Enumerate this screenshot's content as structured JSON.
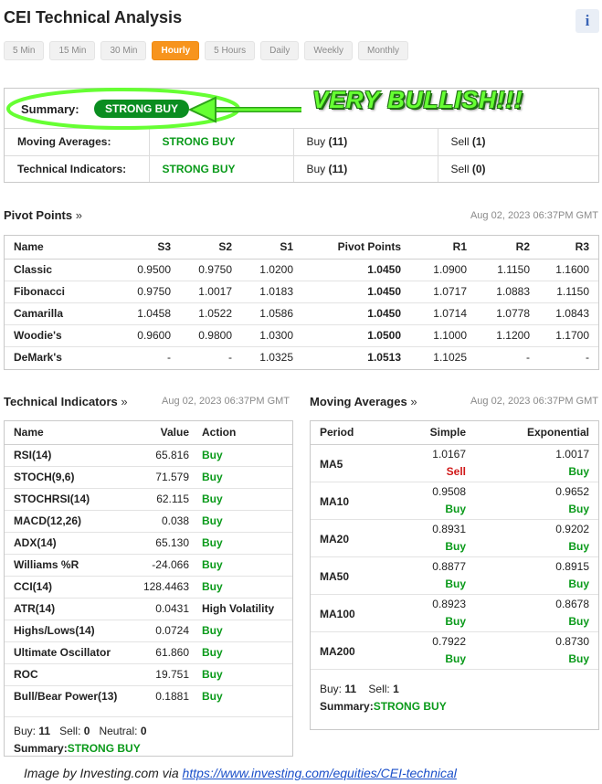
{
  "header": {
    "title": "CEI Technical Analysis",
    "info_icon": "info-icon"
  },
  "tabs": [
    {
      "label": "5 Min",
      "active": false
    },
    {
      "label": "15 Min",
      "active": false
    },
    {
      "label": "30 Min",
      "active": false
    },
    {
      "label": "Hourly",
      "active": true
    },
    {
      "label": "5 Hours",
      "active": false
    },
    {
      "label": "Daily",
      "active": false
    },
    {
      "label": "Weekly",
      "active": false
    },
    {
      "label": "Monthly",
      "active": false
    }
  ],
  "summary": {
    "label": "Summary:",
    "value": "STRONG BUY",
    "annotation": "VERY BULLISH!!!",
    "rows": [
      {
        "name": "Moving Averages:",
        "signal": "STRONG BUY",
        "buy_label": "Buy",
        "buy_count": "(11)",
        "sell_label": "Sell",
        "sell_count": "(1)"
      },
      {
        "name": "Technical Indicators:",
        "signal": "STRONG BUY",
        "buy_label": "Buy",
        "buy_count": "(11)",
        "sell_label": "Sell",
        "sell_count": "(0)"
      }
    ]
  },
  "pivot": {
    "title": "Pivot Points",
    "arrow": "»",
    "timestamp": "Aug 02, 2023 06:37PM GMT",
    "columns": [
      "Name",
      "S3",
      "S2",
      "S1",
      "Pivot Points",
      "R1",
      "R2",
      "R3"
    ],
    "rows": [
      [
        "Classic",
        "0.9500",
        "0.9750",
        "1.0200",
        "1.0450",
        "1.0900",
        "1.1150",
        "1.1600"
      ],
      [
        "Fibonacci",
        "0.9750",
        "1.0017",
        "1.0183",
        "1.0450",
        "1.0717",
        "1.0883",
        "1.1150"
      ],
      [
        "Camarilla",
        "1.0458",
        "1.0522",
        "1.0586",
        "1.0450",
        "1.0714",
        "1.0778",
        "1.0843"
      ],
      [
        "Woodie's",
        "0.9600",
        "0.9800",
        "1.0300",
        "1.0500",
        "1.1000",
        "1.1200",
        "1.1700"
      ],
      [
        "DeMark's",
        "-",
        "-",
        "1.0325",
        "1.0513",
        "1.1025",
        "-",
        "-"
      ]
    ]
  },
  "technical": {
    "title": "Technical Indicators",
    "arrow": "»",
    "timestamp": "Aug 02, 2023 06:37PM GMT",
    "columns": [
      "Name",
      "Value",
      "Action"
    ],
    "rows": [
      {
        "name": "RSI(14)",
        "value": "65.816",
        "action": "Buy"
      },
      {
        "name": "STOCH(9,6)",
        "value": "71.579",
        "action": "Buy"
      },
      {
        "name": "STOCHRSI(14)",
        "value": "62.115",
        "action": "Buy"
      },
      {
        "name": "MACD(12,26)",
        "value": "0.038",
        "action": "Buy"
      },
      {
        "name": "ADX(14)",
        "value": "65.130",
        "action": "Buy"
      },
      {
        "name": "Williams %R",
        "value": "-24.066",
        "action": "Buy"
      },
      {
        "name": "CCI(14)",
        "value": "128.4463",
        "action": "Buy"
      },
      {
        "name": "ATR(14)",
        "value": "0.0431",
        "action": "High Volatility"
      },
      {
        "name": "Highs/Lows(14)",
        "value": "0.0724",
        "action": "Buy"
      },
      {
        "name": "Ultimate Oscillator",
        "value": "61.860",
        "action": "Buy"
      },
      {
        "name": "ROC",
        "value": "19.751",
        "action": "Buy"
      },
      {
        "name": "Bull/Bear Power(13)",
        "value": "0.1881",
        "action": "Buy"
      }
    ],
    "footer": {
      "buy_label": "Buy:",
      "buy": "11",
      "sell_label": "Sell:",
      "sell": "0",
      "neutral_label": "Neutral:",
      "neutral": "0",
      "summary_label": "Summary:",
      "summary": "STRONG BUY"
    }
  },
  "moving": {
    "title": "Moving Averages",
    "arrow": "»",
    "timestamp": "Aug 02, 2023 06:37PM GMT",
    "columns": [
      "Period",
      "Simple",
      "Exponential"
    ],
    "rows": [
      {
        "period": "MA5",
        "simple": "1.0167",
        "simple_action": "Sell",
        "exp": "1.0017",
        "exp_action": "Buy"
      },
      {
        "period": "MA10",
        "simple": "0.9508",
        "simple_action": "Buy",
        "exp": "0.9652",
        "exp_action": "Buy"
      },
      {
        "period": "MA20",
        "simple": "0.8931",
        "simple_action": "Buy",
        "exp": "0.9202",
        "exp_action": "Buy"
      },
      {
        "period": "MA50",
        "simple": "0.8877",
        "simple_action": "Buy",
        "exp": "0.8915",
        "exp_action": "Buy"
      },
      {
        "period": "MA100",
        "simple": "0.8923",
        "simple_action": "Buy",
        "exp": "0.8678",
        "exp_action": "Buy"
      },
      {
        "period": "MA200",
        "simple": "0.7922",
        "simple_action": "Buy",
        "exp": "0.8730",
        "exp_action": "Buy"
      }
    ],
    "footer": {
      "buy_label": "Buy:",
      "buy": "11",
      "sell_label": "Sell:",
      "sell": "1",
      "summary_label": "Summary:",
      "summary": "STRONG BUY"
    }
  },
  "credit": {
    "prefix": "Image by Investing.com via ",
    "link": "https://www.investing.com/equities/CEI-technical"
  },
  "colors": {
    "buy": "#0a9a1a",
    "sell": "#d01818",
    "active_tab": "#f7941d",
    "pill": "#0a8d20",
    "annotation": "#66ff33"
  }
}
